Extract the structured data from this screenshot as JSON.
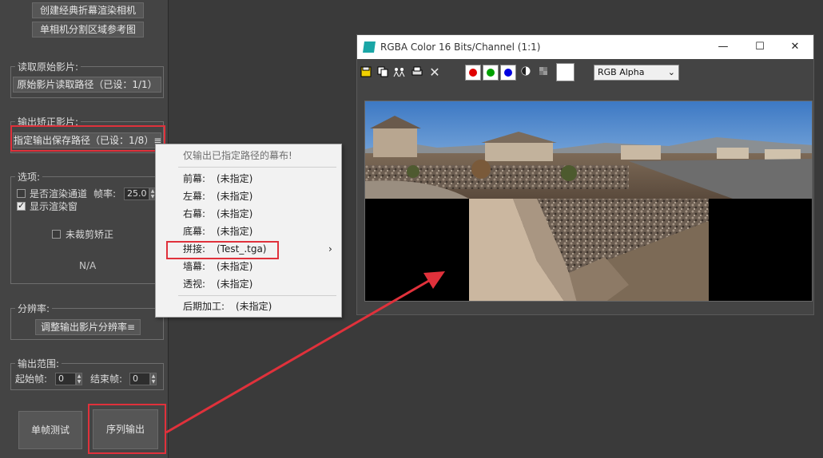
{
  "left_panel": {
    "top_buttons": {
      "create_camera": "创建经典折幕渲染相机",
      "single_camera_ref": "单相机分割区域参考图"
    },
    "read_group": {
      "label": "读取原始影片:",
      "path_button": "原始影片读取路径（已设：1/1）"
    },
    "output_group": {
      "label": "输出矫正影片:",
      "save_path_button": "指定输出保存路径（已设：1/8）≡"
    },
    "options_group": {
      "label": "选项:",
      "render_channel_label": "是否渲染通道",
      "render_channel_checked": false,
      "fps_label": "帧率:",
      "fps_value": "25.0",
      "show_window_label": "显示渲染窗",
      "show_window_checked": true,
      "no_crop_label": "未裁剪矫正",
      "no_crop_checked": false,
      "status_text": "N/A"
    },
    "resolution_group": {
      "label": "分辨率:",
      "adjust_button": "调整输出影片分辨率≡"
    },
    "range_group": {
      "label": "输出范围:",
      "start_label": "起始帧:",
      "start_value": "0",
      "end_label": "结束帧:",
      "end_value": "0"
    },
    "bottom_buttons": {
      "single_frame_test": "单帧测试",
      "sequence_output": "序列输出"
    }
  },
  "context_menu": {
    "header": "仅输出已指定路径的幕布!",
    "items": [
      {
        "label": "前幕:",
        "value": "(未指定)"
      },
      {
        "label": "左幕:",
        "value": "(未指定)"
      },
      {
        "label": "右幕:",
        "value": "(未指定)"
      },
      {
        "label": "底幕:",
        "value": "(未指定)"
      },
      {
        "label": "拼接:",
        "value": "(Test_.tga)",
        "submenu_arrow": "›"
      },
      {
        "label": "墙幕:",
        "value": "(未指定)"
      },
      {
        "label": "透视:",
        "value": "(未指定)"
      }
    ],
    "post_item": {
      "label": "后期加工:",
      "value": "(未指定)"
    }
  },
  "image_window": {
    "title": "RGBA Color 16 Bits/Channel (1:1)",
    "title_buttons": {
      "minimize": "—",
      "maximize": "☐",
      "close": "✕"
    },
    "toolbar_icons": [
      "save-icon",
      "copy-icon",
      "clone-icon",
      "print-icon",
      "clear-icon"
    ],
    "channel_buttons": [
      {
        "name": "red",
        "color": "#e00000"
      },
      {
        "name": "green",
        "color": "#00a000"
      },
      {
        "name": "blue",
        "color": "#0000e0"
      }
    ],
    "channel_select": "RGB Alpha"
  },
  "colors": {
    "highlight_red": "#e0313b",
    "panel_bg": "#444444",
    "app_icon": "#1aa6a6"
  }
}
